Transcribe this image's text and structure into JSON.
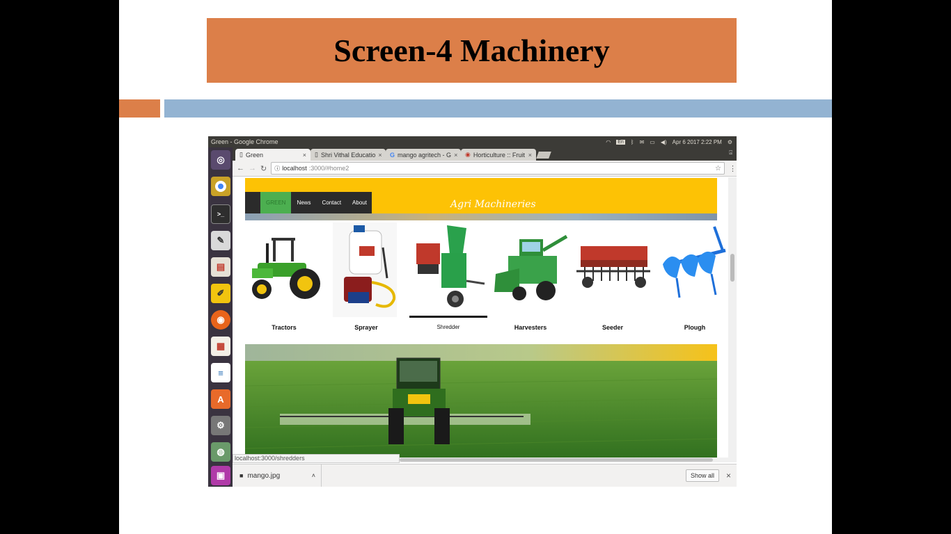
{
  "slide": {
    "title": "Screen-4 Machinery"
  },
  "os": {
    "window_title": "Green - Google Chrome",
    "keyboard_indicator": "En",
    "datetime": "Apr  6 2017  2:22 PM"
  },
  "browser": {
    "tabs": [
      {
        "label": "Green",
        "active": true
      },
      {
        "label": "Shri Vithal Educatio",
        "active": false
      },
      {
        "label": "mango agritech - G",
        "active": false
      },
      {
        "label": "Horticulture :: Fruit",
        "active": false
      }
    ],
    "url_host": "localhost",
    "url_path": ":3000/#home2",
    "status_url": "localhost:3000/shredders",
    "download_file": "mango.jpg",
    "show_all_label": "Show all"
  },
  "site": {
    "nav": [
      "GREEN",
      "News",
      "Contact",
      "About"
    ],
    "header_title": "Agri Machineries",
    "products": [
      {
        "label": "Tractors"
      },
      {
        "label": "Sprayer"
      },
      {
        "label": "Shredder"
      },
      {
        "label": "Harvesters"
      },
      {
        "label": "Seeder"
      },
      {
        "label": "Plough"
      }
    ]
  },
  "colors": {
    "accent_orange": "#dc7f49",
    "accent_blue": "#93b3d2",
    "site_header": "#fdc205",
    "nav_active": "#4caf50"
  }
}
